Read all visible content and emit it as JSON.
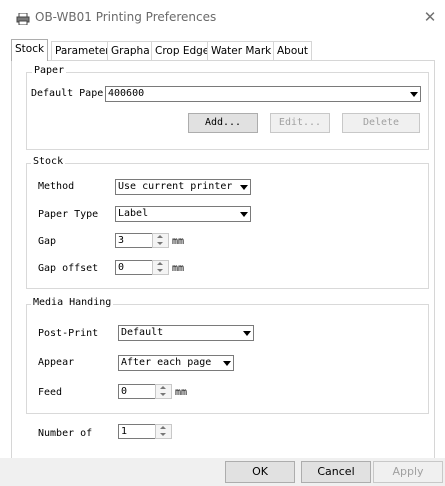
{
  "window": {
    "title": "OB-WB01 Printing Preferences",
    "icon": "printer-icon"
  },
  "tabs": [
    "Stock",
    "Parameters",
    "Grapha",
    "Crop Edge",
    "Water Mark",
    "About"
  ],
  "paper": {
    "legend": "Paper",
    "default_paper_label": "Default Paper",
    "default_paper_value": "400600",
    "add": "Add...",
    "edit": "Edit...",
    "delete": "Delete"
  },
  "stock": {
    "legend": "Stock",
    "method_label": "Method",
    "method_value": "Use current printer s",
    "paper_type_label": "Paper Type",
    "paper_type_value": "Label",
    "gap_label": "Gap",
    "gap_value": "3",
    "gap_unit": "mm",
    "gap_offset_label": "Gap offset",
    "gap_offset_value": "0",
    "gap_offset_unit": "mm"
  },
  "media": {
    "legend": "Media Handing",
    "post_print_label": "Post-Print",
    "post_print_value": "Default",
    "appear_label": "Appear",
    "appear_value": "After each page",
    "feed_label": "Feed",
    "feed_value": "0",
    "feed_unit": "mm"
  },
  "number_of": {
    "label": "Number of",
    "value": "1"
  },
  "footer": {
    "ok": "OK",
    "cancel": "Cancel",
    "apply": "Apply"
  }
}
